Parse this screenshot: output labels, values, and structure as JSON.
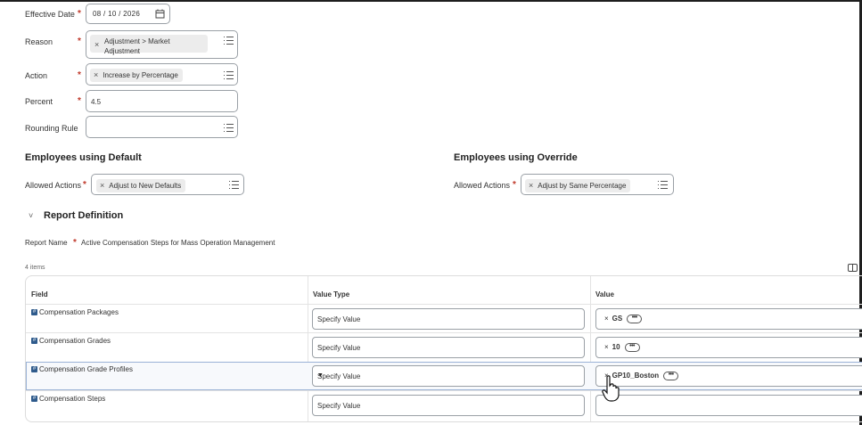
{
  "form": {
    "effective_date": {
      "label": "Effective Date",
      "value": "08 / 10 / 2026"
    },
    "reason": {
      "label": "Reason",
      "chip_line1": "Adjustment > Market",
      "chip_line2": "Adjustment"
    },
    "action": {
      "label": "Action",
      "chip": "Increase by Percentage"
    },
    "percent": {
      "label": "Percent",
      "value": "4.5"
    },
    "rounding_rule": {
      "label": "Rounding Rule",
      "value": ""
    }
  },
  "defaults": {
    "title": "Employees using Default",
    "allowed_actions_label": "Allowed Actions",
    "chip": "Adjust to New Defaults"
  },
  "override": {
    "title": "Employees using Override",
    "allowed_actions_label": "Allowed Actions",
    "chip": "Adjust by Same Percentage"
  },
  "report": {
    "section_title": "Report Definition",
    "name_label": "Report Name",
    "name_value": "Active Compensation Steps for Mass Operation Management",
    "count": "4 items"
  },
  "table": {
    "headers": [
      "Field",
      "Value Type",
      "Value"
    ],
    "rows": [
      {
        "field": "Compensation Packages",
        "value_type": "Specify Value",
        "value": "GS"
      },
      {
        "field": "Compensation Grades",
        "value_type": "Specify Value",
        "value": "10"
      },
      {
        "field": "Compensation Grade Profiles",
        "value_type": "Specify Value",
        "value": "GP10_Boston"
      },
      {
        "field": "Compensation Steps",
        "value_type": "Specify Value",
        "value": ""
      }
    ]
  },
  "icons": {
    "calendar": "calendar-icon",
    "list": "list-icon",
    "remove": "x",
    "more": "•••",
    "dropdown": "▼",
    "expand": "˅"
  },
  "colors": {
    "required": "#c0392b",
    "field_icon": "#2f5b8c",
    "highlight_border": "#9ab2d6"
  }
}
